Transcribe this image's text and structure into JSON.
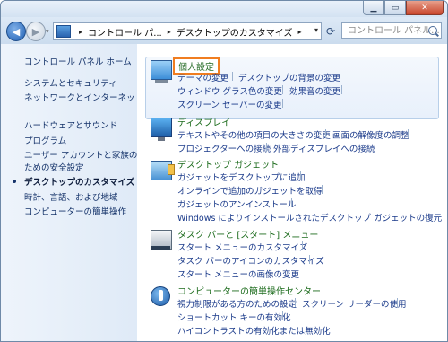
{
  "title_bar": {
    "minimize_label": "▁",
    "maximize_label": "▭",
    "close_label": "✕"
  },
  "nav": {
    "back_glyph": "◀",
    "forward_glyph": "▶",
    "history_glyph": "▾",
    "address": {
      "crumbs": [
        "コントロール パ...",
        "デスクトップのカスタマイズ"
      ],
      "separator": "▸",
      "dropdown_glyph": "▾"
    },
    "refresh_glyph": "⟳",
    "search_placeholder": "コントロール パネル..."
  },
  "sidebar": {
    "items": [
      {
        "label": "コントロール パネル ホーム"
      },
      {
        "label": "システムとセキュリティ"
      },
      {
        "label": "ネットワークとインターネット"
      },
      {
        "label": "ハードウェアとサウンド"
      },
      {
        "label": "プログラム"
      },
      {
        "label": "ユーザー アカウントと家族の"
      },
      {
        "label": "ための安全設定"
      },
      {
        "label": "デスクトップのカスタマイズ",
        "current": true
      },
      {
        "label": "時計、言語、および地域"
      },
      {
        "label": "コンピューターの簡単操作"
      }
    ]
  },
  "sections": [
    {
      "heading": "個人設定",
      "icon": "personalization-icon",
      "links": [
        "テーマの変更",
        "デスクトップの背景の変更",
        "ウィンドウ グラス色の変更",
        "効果音の変更",
        "スクリーン セーバーの変更"
      ]
    },
    {
      "heading": "ディスプレイ",
      "icon": "display-icon",
      "links": [
        "テキストやその他の項目の大きさの変更",
        "画面の解像度の調整",
        "プロジェクターへの接続",
        "外部ディスプレイへの接続"
      ]
    },
    {
      "heading": "デスクトップ ガジェット",
      "icon": "gadget-icon",
      "links": [
        "ガジェットをデスクトップに追加",
        "オンラインで追加のガジェットを取得",
        "ガジェットのアンインストール",
        "Windows によりインストールされたデスクトップ ガジェットの復元"
      ]
    },
    {
      "heading": "タスク バーと [スタート] メニュー",
      "icon": "taskbar-icon",
      "links": [
        "スタート メニューのカスタマイズ",
        "タスク バーのアイコンのカスタマイズ",
        "スタート メニューの画像の変更"
      ]
    },
    {
      "heading": "コンピューターの簡単操作センター",
      "icon": "ease-of-access-icon",
      "links": [
        "視力制限がある方のための設定",
        "スクリーン リーダーの使用",
        "ショートカット キーの有効化",
        "ハイコントラストの有効化または無効化"
      ]
    }
  ],
  "colors": {
    "highlight_border": "#f07d20",
    "link": "#1a3a8a",
    "heading": "#1a6a1a"
  }
}
